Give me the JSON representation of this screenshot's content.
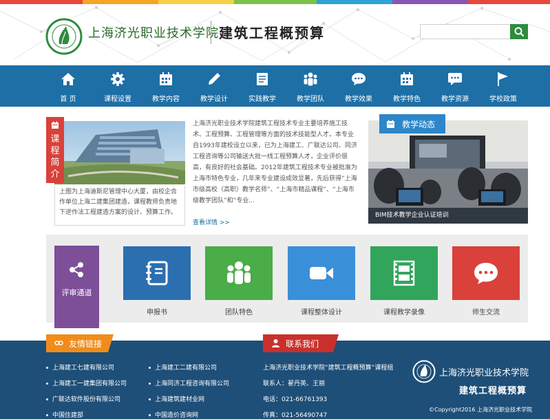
{
  "colors": {
    "nav_bg": "#1d6fa6",
    "footer_bg": "#1e4f78",
    "intro_tag": "#d9413a",
    "news_tag": "#2d86c9",
    "search_btn": "#2e8b3f",
    "friend_links_tag": "#f08c1a",
    "contact_tag": "#c9302c",
    "review_tile": "#7d4f99"
  },
  "header": {
    "seal_icon": "school-seal-icon",
    "school_name": "上海济光职业技术学院",
    "course_name": "建筑工程概预算",
    "search_placeholder": "",
    "search_icon": "search-icon"
  },
  "nav": {
    "items": [
      {
        "label": "首  页",
        "icon": "home-icon"
      },
      {
        "label": "课程设置",
        "icon": "gear-icon"
      },
      {
        "label": "教学内容",
        "icon": "calendar-icon"
      },
      {
        "label": "教学设计",
        "icon": "pencil-icon"
      },
      {
        "label": "实践教学",
        "icon": "document-icon"
      },
      {
        "label": "教学团队",
        "icon": "team-icon"
      },
      {
        "label": "教学效果",
        "icon": "chat-icon"
      },
      {
        "label": "教学特色",
        "icon": "calendar-icon"
      },
      {
        "label": "教学资源",
        "icon": "chat-icon"
      },
      {
        "label": "学校政策",
        "icon": "flag-icon"
      }
    ]
  },
  "intro": {
    "tag": "课程简介",
    "photo_caption": "上图为上海迪斯尼管理中心大厦，由校企合作单位上海二建集团建造，课程教师负责地下逆作法工程建造方案的设计、预算工作。",
    "text": "上海济光职业技术学院建筑工程技术专业主要培养施工技术、工程预算、工程管理等方面的技术技能型人才。本专业自1993年建校设立以来，已为上海建工、广联达公司、同济工程咨询等公司输送大批一线工程预算人才，企业评价很高，有良好的社会基础。2012年建筑工程技术专业被批准为上海市特色专业，几年来专业建设成效显著，先后获得“上海市级高校（高职）教学名师”、“上海市精品课程”、“上海市级教学团队”和“专业...",
    "more": "查看详情 >>"
  },
  "news": {
    "tag": "教学动态",
    "caption": "BIM技术教学企业认证培训"
  },
  "tiles": {
    "review": {
      "label": "评审通道",
      "icon": "share-icon"
    },
    "items": [
      {
        "label": "申报书",
        "icon": "notebook-icon",
        "color": "#2b6fb1"
      },
      {
        "label": "团队特色",
        "icon": "team-icon",
        "color": "#4aad48"
      },
      {
        "label": "课程整体设计",
        "icon": "video-camera-icon",
        "color": "#3a8fd9"
      },
      {
        "label": "课程教学录像",
        "icon": "film-icon",
        "color": "#31a55b"
      },
      {
        "label": "师生交流",
        "icon": "chat-icon",
        "color": "#d9413a"
      }
    ]
  },
  "footer": {
    "links_title": "友情链接",
    "links": [
      "上海建工七建有限公司",
      "上海建工二建有限公司",
      "上海建工一建集团有限公司",
      "上海同济工程咨询有限公司",
      "广联达软件股份有限公司",
      "上海建筑建材业网",
      "中国住建部",
      "中国造价咨询网"
    ],
    "contact_title": "联系我们",
    "contact": [
      "上海济光职业技术学院“建筑工程概预算”课程组",
      "联系人：翟丹英、王丽",
      "电话：021-66761393",
      "传真：021-56490747"
    ],
    "school_name": "上海济光职业技术学院",
    "course_name": "建筑工程概预算",
    "copyright": "©Copyright2016 上海济光职业技术学院"
  }
}
